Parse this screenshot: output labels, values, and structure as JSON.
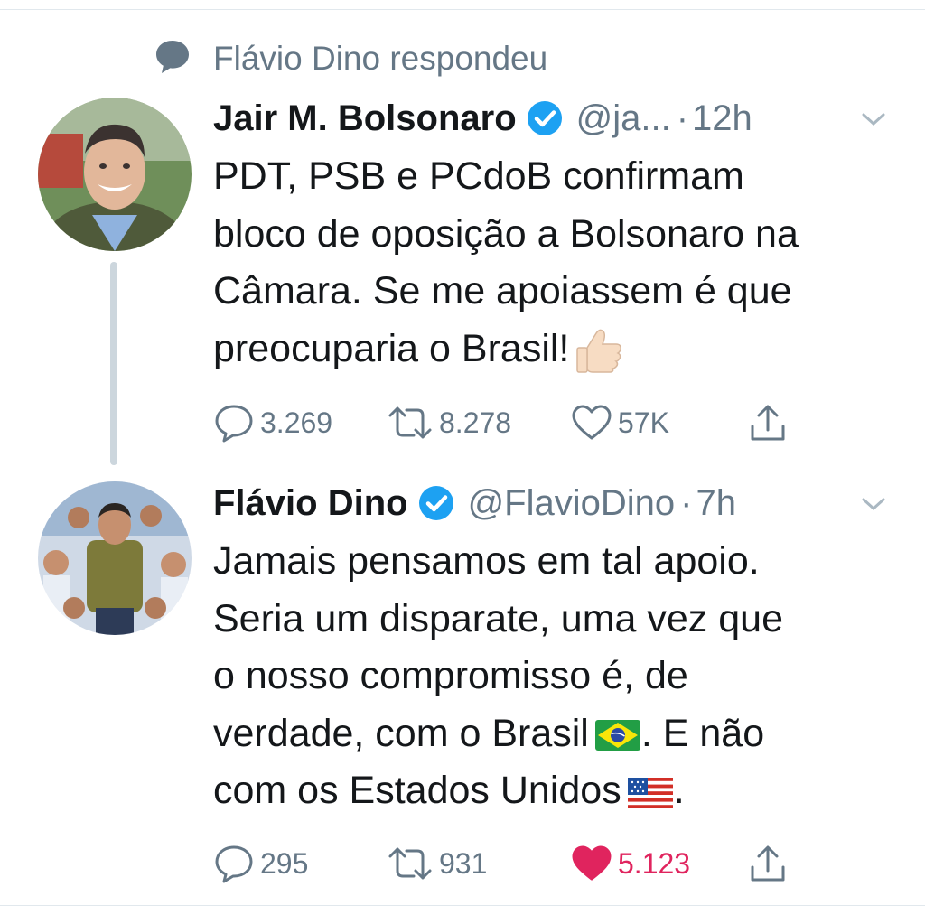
{
  "context": {
    "text": "Flávio Dino respondeu",
    "icon": "speech-bubble-icon"
  },
  "colors": {
    "verified": "#1da1f2",
    "secondary": "#657786",
    "like_active": "#e0245e",
    "thread_line": "#ccd6dd"
  },
  "tweets": [
    {
      "name": "Jair M. Bolsonaro",
      "handle": "@ja...",
      "separator": "·",
      "time": "12h",
      "lines": [
        "PDT, PSB e PCdoB confirmam",
        "bloco de oposição a Bolsonaro na",
        "Câmara. Se me apoiassem é que",
        "preocuparia o Brasil!"
      ],
      "emoji": "thumbs-up",
      "replies": "3.269",
      "retweets": "8.278",
      "likes": "57K",
      "liked": false
    },
    {
      "name": "Flávio Dino",
      "handle": "@FlavioDino",
      "separator": "·",
      "time": "7h",
      "lines": [
        "Jamais pensamos em tal apoio.",
        "Seria um disparate, uma vez que",
        "o nosso compromisso é, de",
        "verdade, com o Brasil",
        ". E não",
        "com os Estados Unidos",
        "."
      ],
      "emoji_inline": [
        "brazil-flag",
        "usa-flag"
      ],
      "replies": "295",
      "retweets": "931",
      "likes": "5.123",
      "liked": true
    }
  ]
}
